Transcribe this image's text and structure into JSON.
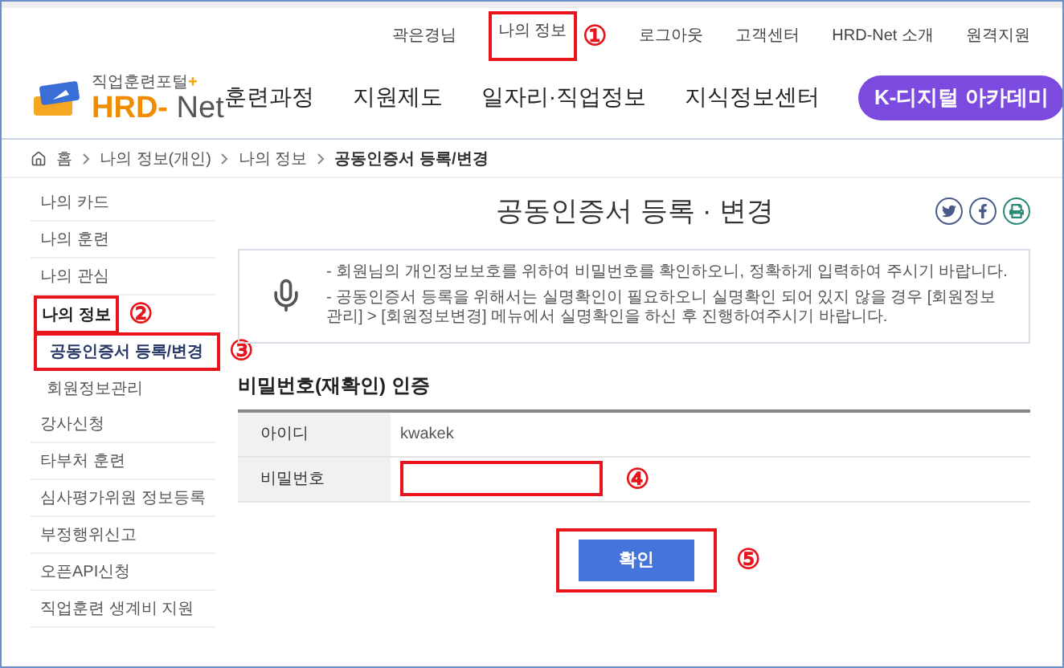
{
  "top_links": [
    {
      "label": "곽은경님"
    },
    {
      "label": "나의 정보",
      "marker": "①"
    },
    {
      "label": "로그아웃"
    },
    {
      "label": "고객센터"
    },
    {
      "label": "HRD-Net 소개"
    },
    {
      "label": "원격지원"
    }
  ],
  "logo": {
    "tagline": "직업훈련포털",
    "plus": "+",
    "brand_a": "HRD",
    "dash": "-",
    "brand_b": "Net"
  },
  "nav": [
    {
      "label": "훈련과정",
      "kind": "link"
    },
    {
      "label": "지원제도",
      "kind": "link"
    },
    {
      "label": "일자리·직업정보",
      "kind": "link"
    },
    {
      "label": "지식정보센터",
      "kind": "link"
    },
    {
      "label": "K-디지털 아카데미",
      "kind": "pill"
    }
  ],
  "breadcrumb": [
    "홈",
    "나의 정보(개인)",
    "나의 정보",
    "공동인증서 등록/변경"
  ],
  "sidebar": [
    {
      "label": "나의 카드"
    },
    {
      "label": "나의 훈련"
    },
    {
      "label": "나의 관심"
    },
    {
      "label": "나의 정보",
      "marker": "②",
      "children": [
        {
          "label": "공동인증서 등록/변경",
          "selected": true,
          "marker": "③"
        },
        {
          "label": "회원정보관리",
          "selected": false
        }
      ]
    },
    {
      "label": "강사신청"
    },
    {
      "label": "타부처 훈련"
    },
    {
      "label": "심사평가위원 정보등록"
    },
    {
      "label": "부정행위신고"
    },
    {
      "label": "오픈API신청"
    },
    {
      "label": "직업훈련 생계비 지원"
    }
  ],
  "page_title": "공동인증서 등록 · 변경",
  "notice": [
    "- 회원님의 개인정보보호를 위하여 비밀번호를 확인하오니, 정확하게 입력하여 주시기 바랍니다.",
    "- 공동인증서 등록을 위해서는 실명확인이 필요하오니 실명확인 되어 있지 않을 경우 [회원정보관리] > [회원정보변경] 메뉴에서 실명확인을 하신 후 진행하여주시기 바랍니다."
  ],
  "section_title": "비밀번호(재확인) 인증",
  "form": [
    {
      "label": "아이디",
      "kind": "text",
      "value": "kwakek"
    },
    {
      "label": "비밀번호",
      "kind": "input",
      "marker": "④"
    }
  ],
  "confirm": {
    "label": "확인",
    "marker": "⑤"
  }
}
